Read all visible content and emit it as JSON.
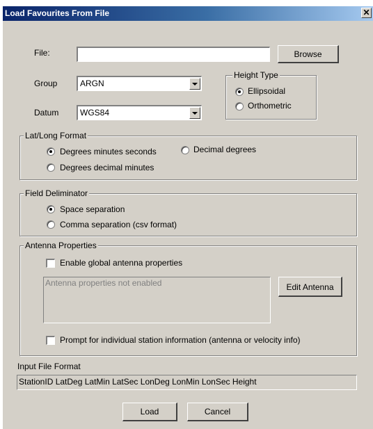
{
  "window": {
    "title": "Load Favourites From File",
    "close_glyph": "✕"
  },
  "file": {
    "label": "File:",
    "value": "",
    "browse_label": "Browse"
  },
  "group": {
    "label": "Group",
    "selected": "ARGN"
  },
  "datum": {
    "label": "Datum",
    "selected": "WGS84"
  },
  "height_type": {
    "legend": "Height Type",
    "options": [
      {
        "label": "Ellipsoidal",
        "checked": true
      },
      {
        "label": "Orthometric",
        "checked": false
      }
    ]
  },
  "latlong_format": {
    "legend": "Lat/Long Format",
    "options": [
      {
        "label": "Degrees minutes seconds",
        "checked": true
      },
      {
        "label": "Decimal degrees",
        "checked": false
      },
      {
        "label": "Degrees decimal minutes",
        "checked": false
      }
    ]
  },
  "field_delim": {
    "legend": "Field Deliminator",
    "options": [
      {
        "label": "Space separation",
        "checked": true
      },
      {
        "label": "Comma separation (csv format)",
        "checked": false
      }
    ]
  },
  "antenna": {
    "legend": "Antenna Properties",
    "enable_label": "Enable global antenna properties",
    "enable_checked": false,
    "status_text": "Antenna properties not enabled",
    "edit_label": "Edit Antenna",
    "prompt_label": "Prompt for individual station information (antenna or velocity info)",
    "prompt_checked": false
  },
  "input_format": {
    "label": "Input File Format",
    "value": "StationID LatDeg LatMin LatSec LonDeg LonMin LonSec Height"
  },
  "buttons": {
    "load_label": "Load",
    "cancel_label": "Cancel"
  }
}
